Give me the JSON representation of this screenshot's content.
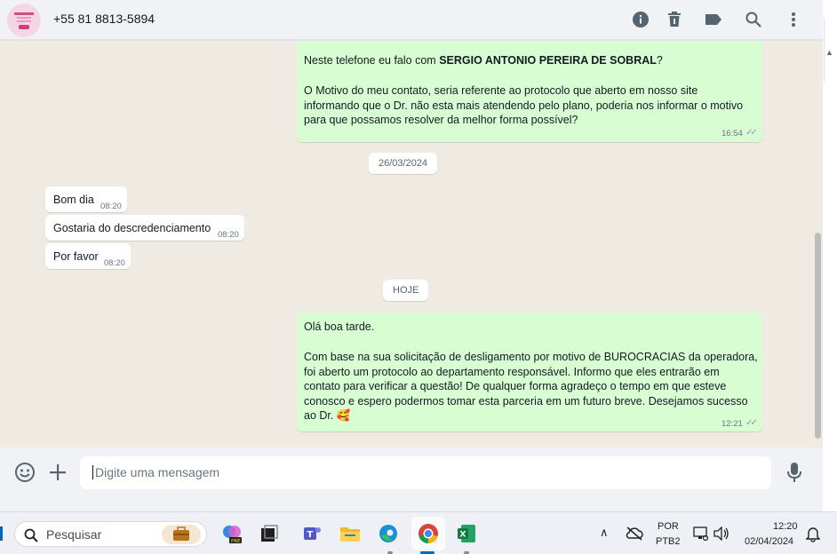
{
  "header": {
    "contact_name": "+55 81 8813-5894",
    "icons": [
      "info-icon",
      "trash-icon",
      "label-icon",
      "search-icon",
      "menu-icon"
    ]
  },
  "chat": {
    "messages": [
      {
        "direction": "out",
        "line1_prefix": "Neste telefone eu falo com ",
        "line1_bold": "SERGIO ANTONIO PEREIRA DE SOBRAL",
        "line1_suffix": "?",
        "para2": [
          "O Motivo do meu contato, seria referente ao protocolo que aberto em nosso site",
          "informando que o Dr. não esta mais atendendo pelo plano, poderia nos informar o motivo",
          "para que possamos resolver da melhor forma possível?"
        ],
        "time": "16:54"
      },
      {
        "type": "date",
        "label": "26/03/2024"
      },
      {
        "direction": "in",
        "text": "Bom dia",
        "time": "08:20"
      },
      {
        "direction": "in",
        "text": "Gostaria do descredenciamento",
        "time": "08:20"
      },
      {
        "direction": "in",
        "text": "Por favor",
        "time": "08:20"
      },
      {
        "type": "date",
        "label": "HOJE"
      },
      {
        "direction": "out",
        "greeting": "Olá boa tarde.",
        "body": [
          "Com base na sua solicitação de desligamento por motivo de BUROCRACIAS da operadora,",
          "foi aberto um protocolo ao departamento responsável. Informo que eles entrarão em",
          "contato para verificar a questão! De qualquer forma agradeço o tempo em que esteve",
          "conosco e espero podermos tomar esta parceria em um futuro breve. Desejamos sucesso",
          "ao Dr."
        ],
        "emoji": "🥰",
        "time": "12:21"
      }
    ]
  },
  "composer": {
    "placeholder": "Digite uma mensagem"
  },
  "taskbar": {
    "search_label": "Pesquisar",
    "language": "POR",
    "layout": "PTB2",
    "clock_time": "12:20",
    "clock_date": "02/04/2024"
  },
  "colors": {
    "outgoing_bubble": "#d9fdd3",
    "incoming_bubble": "#ffffff",
    "chat_background": "#efeae2",
    "header_background": "#f0f2f5"
  }
}
